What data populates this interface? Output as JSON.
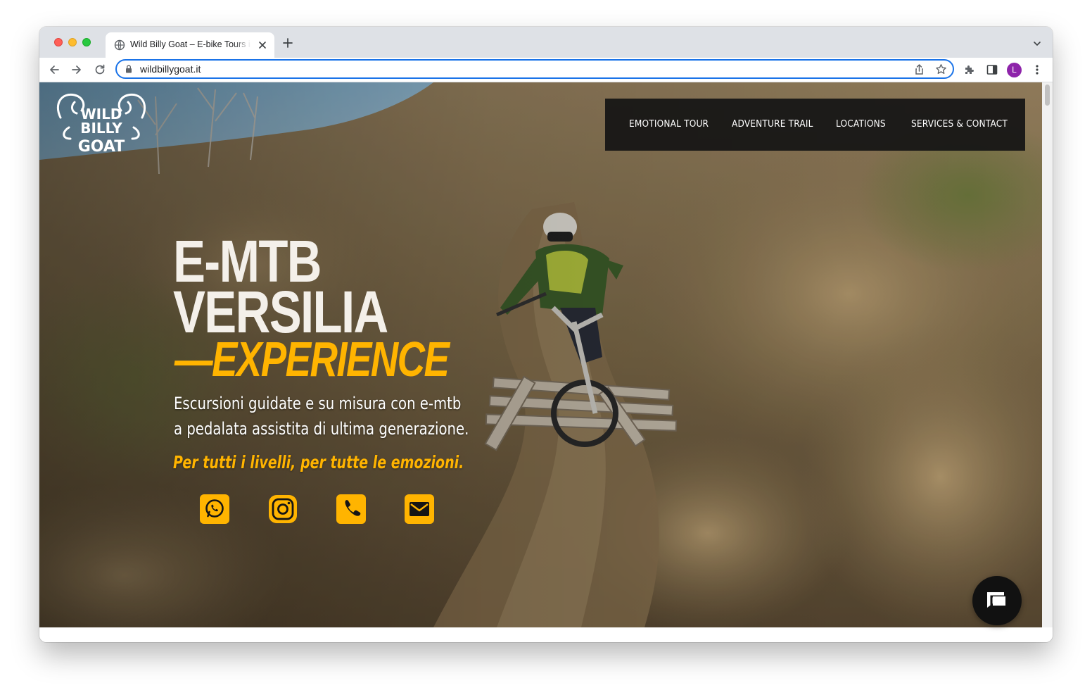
{
  "browser": {
    "tab_title": "Wild Billy Goat – E-bike Tours in Versilia",
    "url": "wildbillygoat.it",
    "profile_initial": "L",
    "profile_color": "#8e24aa"
  },
  "site": {
    "logo_text": "Wild Billy Goat",
    "nav": [
      "EMOTIONAL TOUR",
      "ADVENTURE TRAIL",
      "LOCATIONS",
      "SERVICES & CONTACT"
    ],
    "hero": {
      "title_line1": "E-MTB",
      "title_line2": "VERSILIA",
      "title_line3": "—EXPERIENCE",
      "subtitle_line1": "Escursioni guidate e su misura con e-mtb",
      "subtitle_line2": "a pedalata assistita di ultima generazione.",
      "tagline": "Per tutti i livelli, per tutte le emozioni."
    },
    "social": [
      "whatsapp-icon",
      "instagram-icon",
      "phone-icon",
      "email-icon"
    ],
    "colors": {
      "accent": "#ffb400",
      "nav_bg": "#141414",
      "title": "#f4f0ea"
    }
  }
}
